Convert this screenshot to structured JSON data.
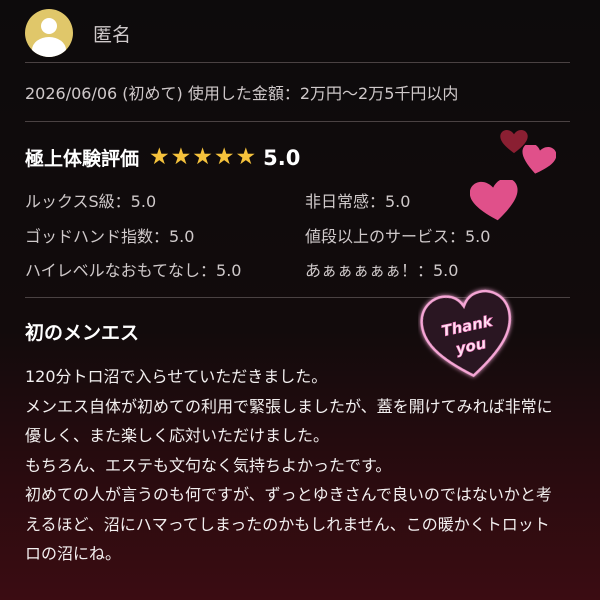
{
  "header": {
    "username": "匿名",
    "meta": "2026/06/06 (初めて) 使用した金額：2万円〜2万5千円以内"
  },
  "rating": {
    "title": "極上体験評価",
    "stars": 5,
    "score": "5.0",
    "star_color": "#f5c23c",
    "items": [
      {
        "label": "ルックスS級：5.0"
      },
      {
        "label": "非日常感：5.0"
      },
      {
        "label": "ゴッドハンド指数：5.0"
      },
      {
        "label": "値段以上のサービス：5.0"
      },
      {
        "label": "ハイレベルなおもてなし：5.0"
      },
      {
        "label": "あぁぁぁぁぁ！：5.0"
      }
    ]
  },
  "review": {
    "title": "初のメンエス",
    "lines": [
      "120分トロ沼で入らせていただきました。",
      "メンエス自体が初めての利用で緊張しましたが、蓋を開けてみれば非常に優しく、また楽しく応対いただけました。",
      "もちろん、エステも文句なく気持ちよかったです。",
      "初めての人が言うのも何ですが、ずっとゆきさんで良いのではないかと考えるほど、沼にハマってしまったのかもしれません、この暖かくトロットロの沼にね。"
    ]
  },
  "sticker": {
    "line1": "Thank",
    "line2": "you"
  },
  "colors": {
    "accent_pink": "#e0508a",
    "neon_pink": "#f6a6d6",
    "avatar_gold": "#e0c76a"
  }
}
